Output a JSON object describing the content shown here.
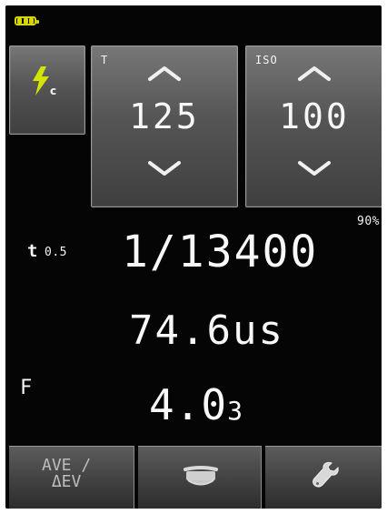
{
  "screen": {
    "battery_icon": "battery-full-icon",
    "flash_mode": {
      "icon": "flash-icon",
      "subscript": "c"
    },
    "shutter": {
      "label": "T",
      "value": "125",
      "up_icon": "chevron-up-icon",
      "down_icon": "chevron-down-icon"
    },
    "iso": {
      "label": "ISO",
      "value": "100",
      "up_icon": "chevron-up-icon",
      "down_icon": "chevron-down-icon"
    },
    "percentage": "90%",
    "measurement": {
      "t_label": "t",
      "t_sub": "0.5",
      "duration_fraction": "1/13400",
      "duration_us": "74.6us",
      "f_label": "F",
      "f_value_main": "4.0",
      "f_value_sub": "3"
    },
    "bottom_bar": {
      "left_label": "AVE /\nΔEV",
      "middle_icon": "flash-bell-icon",
      "right_icon": "wrench-icon"
    }
  }
}
